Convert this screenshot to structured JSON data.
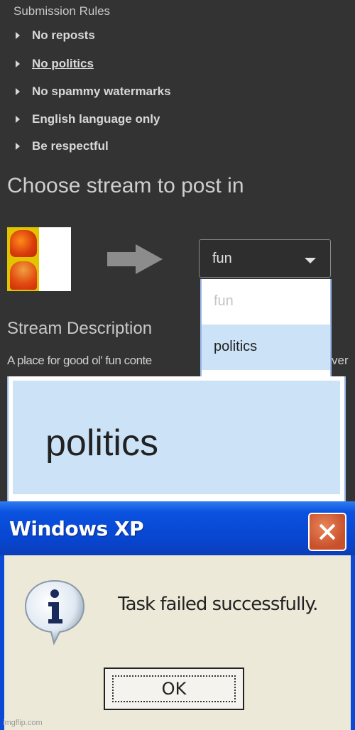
{
  "rules": {
    "title": "Submission Rules",
    "items": [
      {
        "label": "No reposts",
        "link": false
      },
      {
        "label": "No politics",
        "link": true
      },
      {
        "label": "No spammy watermarks",
        "link": false
      },
      {
        "label": "English language only",
        "link": false
      },
      {
        "label": "Be respectful",
        "link": false
      }
    ]
  },
  "stream": {
    "heading": "Choose stream to post in",
    "selected": "fun",
    "options": [
      "fun",
      "politics"
    ],
    "highlighted_option": "politics"
  },
  "description": {
    "heading": "Stream Description",
    "text": "A place for good ol' fun conte",
    "text_tail": "ver"
  },
  "zoomed_option": "politics",
  "dialog": {
    "title": "Windows XP",
    "message": "Task failed successfully.",
    "ok_label": "OK"
  },
  "watermark": "imgflip.com",
  "colors": {
    "background": "#333333",
    "highlight": "#cce3f7",
    "xp_blue": "#0a52e0",
    "dialog_body": "#ece9d8"
  }
}
